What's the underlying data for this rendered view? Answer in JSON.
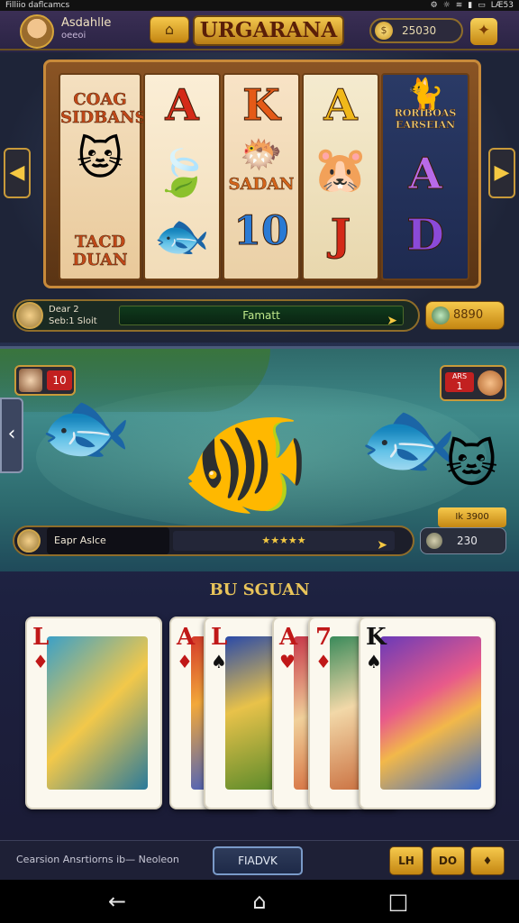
{
  "status": {
    "left": "Filliio daflcamcs",
    "right_icons": [
      "settings-icon",
      "brightness-icon",
      "wifi-icon",
      "signal-icon",
      "battery-icon"
    ],
    "time": "LÆ53"
  },
  "header": {
    "player_name": "Asdahlle",
    "player_level": "oeeoi",
    "game_title": "URGARANA",
    "coins": "25030"
  },
  "slot": {
    "reel1_top": "COAG SIDBANS",
    "reel1_bottom": "TACD DUAN",
    "reel2_top": "A",
    "reel3_top": "K",
    "reel3_mid": "SADAN",
    "reel3_bottom": "10",
    "reel4_top": "A",
    "reel4_bottom": "J",
    "reel5_top": "RORIBOAS EARSEIAN",
    "reel5_mid": "A",
    "reel5_bottom": "D",
    "bet_label_1": "Dear  2",
    "bet_label_2": "Seb:1 Sloit",
    "bet_bar_text": "Famatt",
    "win_value": "8890"
  },
  "fishing": {
    "player1_score": "10",
    "player2_score": "1",
    "player2_label": "ARS",
    "reward": "Ik 3900",
    "player_name": "Eapr Aslce",
    "stars": "★★★★★",
    "score": "230"
  },
  "cards": {
    "title": "BU SGUAN",
    "items": [
      {
        "rank": "L",
        "suit": "♦"
      },
      {
        "rank": "A",
        "suit": "♦"
      },
      {
        "rank": "L",
        "suit": "♠"
      },
      {
        "rank": "A",
        "suit": "♥"
      },
      {
        "rank": "7",
        "suit": "♦"
      },
      {
        "rank": "K",
        "suit": "♠"
      }
    ]
  },
  "bottom": {
    "text": "Cearsion Ansrtiorns ib— Neoleon",
    "play_label": "FIADVK",
    "btn1": "LH",
    "btn2": "DO",
    "btn3": "♦"
  },
  "colors": {
    "gold": "#f6c94c",
    "panel": "#2a2a34",
    "accent_red": "#c22020"
  }
}
